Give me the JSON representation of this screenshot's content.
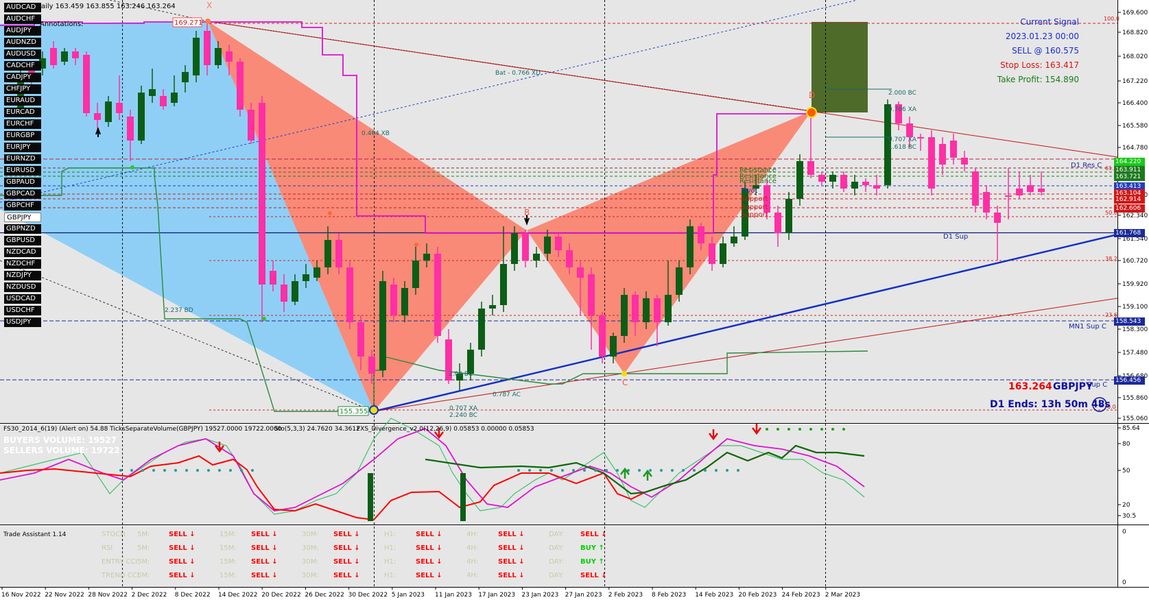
{
  "header": {
    "ohlc": "aily  163.459 163.855 163.246 163.264",
    "annotations": "Annotations:"
  },
  "symbols": [
    "AUDCAD",
    "AUDCHF",
    "AUDJPY",
    "AUDNZD",
    "AUDUSD",
    "CADCHF",
    "CADJPY",
    "CHFJPY",
    "EURAUD",
    "EURCAD",
    "EURCHF",
    "EURGBP",
    "EURJPY",
    "EURNZD",
    "EURUSD",
    "GBPAUD",
    "GBPCAD",
    "GBPCHF",
    "GBPJPY",
    "GBPNZD",
    "GBPUSD",
    "NZDCAD",
    "NZDCHF",
    "NZDJPY",
    "NZDUSD",
    "USDCAD",
    "USDCHF",
    "USDJPY"
  ],
  "active_symbol": "GBPJPY",
  "signal": {
    "title": "Current Signal",
    "date": "2023.01.23 00:00",
    "action": "SELL @ 160.575",
    "stop_loss": "Stop Loss: 163.417",
    "take_profit": "Take Profit: 154.890"
  },
  "pattern": {
    "x_label": "X",
    "b_label": "B",
    "c_label": "C",
    "d_label": "D",
    "x_price": "169.271",
    "a_price": "155.355",
    "bat": "Bat - 0.766 XD",
    "xb": "0.464 XB",
    "bd": "2.237 BD",
    "ac": "0.787 AC",
    "xa_1": "0.707 XA",
    "bc_1": "2.240 BC",
    "bc_2": "2.00 BC",
    "d_2000bc": "2.000 BC",
    "d_786xa": "0.786 XA",
    "d_707xa": "0.707 XA",
    "d_1618bc": "1.618 BC"
  },
  "levels": {
    "d1_res": "D1 Res C",
    "d1_sup": "D1 Sup",
    "mn1_sup": "MN1 Sup C",
    "sup_c": "Sup C",
    "pivot": "Pivot",
    "support": "Support",
    "resistance": "Resistance",
    "fib_100": "100.0",
    "fib_618": "61.8",
    "fib_50": "50.0",
    "fib_382": "38.2",
    "fib_236": "23.6",
    "fib_0": "0.0"
  },
  "price_info": {
    "price": "163.264",
    "pair": "GBPJPY",
    "ends": "D1 Ends: 13h 50m 48s"
  },
  "price_axis": [
    "169.600",
    "168.820",
    "168.020",
    "167.220",
    "166.400",
    "165.580",
    "164.780",
    "163.100",
    "162.340",
    "161.540",
    "160.720",
    "159.920",
    "159.100",
    "158.300",
    "157.480",
    "156.680",
    "155.860",
    "155.060"
  ],
  "price_tags": [
    {
      "v": "164.220",
      "c": "#19c819"
    },
    {
      "v": "163.911",
      "c": "#1e7a1e"
    },
    {
      "v": "163.721",
      "c": "#1e7a1e"
    },
    {
      "v": "163.413",
      "c": "#1f3fbf"
    },
    {
      "v": "163.104",
      "c": "#d01818"
    },
    {
      "v": "162.914",
      "c": "#d01818"
    },
    {
      "v": "162.606",
      "c": "#d01818"
    },
    {
      "v": "161.768",
      "c": "#1a2a9a"
    },
    {
      "v": "158.543",
      "c": "#1a2a9a"
    },
    {
      "v": "156.456",
      "c": "#1a2a9a"
    }
  ],
  "indicator": {
    "title": "FS30_2014_6(19) (Alert on) 54.88  TicksSeparateVolume(GBPJPY) 19527.0000 19722.0000",
    "sto": "Sto(5,3,3) 24.7620 34.3612",
    "fxs": "FXS_Divergence_v2.0(12,26,9) 0.05853 0.00000 0.05853",
    "buy_vol": "BUYERS VOLUME: 19527",
    "sell_vol": "SELLERS VOLUME: 19722",
    "axis": [
      "85.64",
      "80",
      "50",
      "20",
      "30.5"
    ]
  },
  "trade_assistant": {
    "title": "Trade Assistant 1.14",
    "axis": [
      "0",
      "0"
    ],
    "rows": [
      {
        "name": "STOCH",
        "cells": [
          [
            "5M:",
            "SELL"
          ],
          [
            "15M:",
            "SELL"
          ],
          [
            "30M:",
            "SELL"
          ],
          [
            "H1:",
            "SELL"
          ],
          [
            "4H:",
            "SELL"
          ],
          [
            "DAY:",
            "SELL"
          ]
        ]
      },
      {
        "name": "RSI",
        "cells": [
          [
            "5M:",
            "SELL"
          ],
          [
            "15M:",
            "SELL"
          ],
          [
            "30M:",
            "SELL"
          ],
          [
            "H1:",
            "SELL"
          ],
          [
            "4H:",
            "SELL"
          ],
          [
            "DAY:",
            "BUY"
          ]
        ]
      },
      {
        "name": "ENTRY CCI",
        "cells": [
          [
            "5M:",
            "SELL"
          ],
          [
            "15M:",
            "SELL"
          ],
          [
            "30M:",
            "SELL"
          ],
          [
            "H1:",
            "SELL"
          ],
          [
            "4H:",
            "SELL"
          ],
          [
            "DAY:",
            "BUY"
          ]
        ]
      },
      {
        "name": "TREND CCI",
        "cells": [
          [
            "5M:",
            "SELL"
          ],
          [
            "15M:",
            "SELL"
          ],
          [
            "30M:",
            "SELL"
          ],
          [
            "H1:",
            "SELL"
          ],
          [
            "4H:",
            "SELL"
          ],
          [
            "DAY:",
            "SELL"
          ]
        ]
      }
    ]
  },
  "time_axis": [
    "16 Nov 2022",
    "22 Nov 2022",
    "28 Nov 2022",
    "2 Dec 2022",
    "8 Dec 2022",
    "14 Dec 2022",
    "20 Dec 2022",
    "26 Dec 2022",
    "30 Dec 2022",
    "5 Jan 2023",
    "11 Jan 2023",
    "17 Jan 2023",
    "23 Jan 2023",
    "27 Jan 2023",
    "2 Feb 2023",
    "8 Feb 2023",
    "14 Feb 2023",
    "20 Feb 2023",
    "24 Feb 2023",
    "2 Mar 2023"
  ],
  "colors": {
    "bull": "#0b5e16",
    "bear": "#ff2fa5",
    "pattern_red": "#f98a78",
    "pattern_blue": "#8fcff6",
    "bg": "#e6e6e6"
  }
}
